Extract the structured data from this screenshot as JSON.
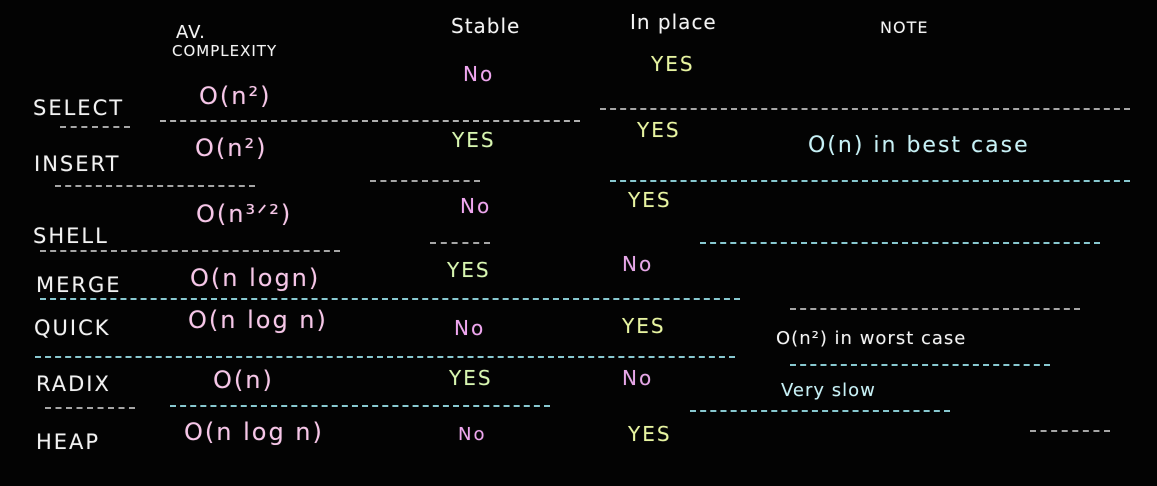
{
  "headers": {
    "complexity_line1": "AV.",
    "complexity_line2": "COMPLEXITY",
    "stable": "Stable",
    "inplace": "In place",
    "note": "NOTE"
  },
  "rows": [
    {
      "name": "SELECT",
      "complexity": "O(n²)",
      "stable": "No",
      "inplace": "YES",
      "note": ""
    },
    {
      "name": "INSERT",
      "complexity": "O(n²)",
      "stable": "YES",
      "inplace": "YES",
      "note": "O(n) in best case"
    },
    {
      "name": "SHELL",
      "complexity": "O(n³ᐟ²)",
      "stable": "No",
      "inplace": "YES",
      "note": ""
    },
    {
      "name": "MERGE",
      "complexity": "O(n logn)",
      "stable": "YES",
      "inplace": "No",
      "note": ""
    },
    {
      "name": "QUICK",
      "complexity": "O(n log n)",
      "stable": "No",
      "inplace": "YES",
      "note": "O(n²) in worst case"
    },
    {
      "name": "RADIX",
      "complexity": "O(n)",
      "stable": "YES",
      "inplace": "No",
      "note": "Very slow"
    },
    {
      "name": "HEAP",
      "complexity": "O(n log n)",
      "stable": "No",
      "inplace": "YES",
      "note": ""
    }
  ],
  "colors": {
    "background": "#030303",
    "chalk_white": "#f4f4f4",
    "complexity_pink": "#f7c6e8",
    "stable_no": "#f0a6f0",
    "stable_yes": "#d8f7b0",
    "inplace_yes": "#e8f5a0",
    "inplace_no": "#e7a6e8",
    "note_cyan": "#c7f2f7",
    "divider_cyan": "#a0ebf5"
  }
}
